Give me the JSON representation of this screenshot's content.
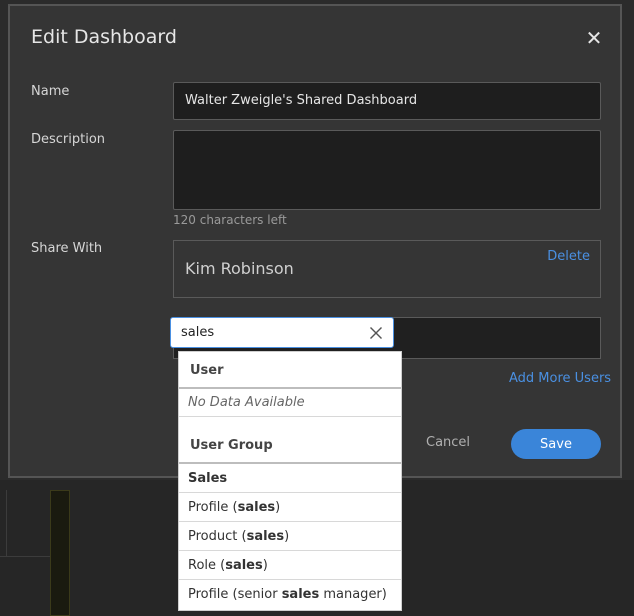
{
  "dialog": {
    "title": "Edit Dashboard",
    "close_label": "✕"
  },
  "form": {
    "name_label": "Name",
    "name_value": "Walter Zweigle's Shared Dashboard",
    "description_label": "Description",
    "description_value": "",
    "chars_left": "120 characters left",
    "share_label": "Share With"
  },
  "share": {
    "users": [
      {
        "name": "Kim Robinson",
        "delete_label": "Delete"
      }
    ],
    "search_value": "sales",
    "add_more_label": "Add More Users"
  },
  "dropdown": {
    "user_header": "User",
    "user_empty": "No Data Available",
    "group_header": "User Group",
    "items": [
      {
        "before": "",
        "match": "Sales",
        "after": ""
      },
      {
        "before": "Profile (",
        "match": "sales",
        "after": ")"
      },
      {
        "before": "Product (",
        "match": "sales",
        "after": ")"
      },
      {
        "before": "Role (",
        "match": "sales",
        "after": ")"
      },
      {
        "before": "Profile (senior ",
        "match": "sales",
        "after": " manager)"
      }
    ]
  },
  "actions": {
    "cancel_label": "Cancel",
    "save_label": "Save"
  },
  "colors": {
    "accent": "#3a85d9",
    "link": "#4a90e2",
    "modal_bg": "#353535"
  }
}
